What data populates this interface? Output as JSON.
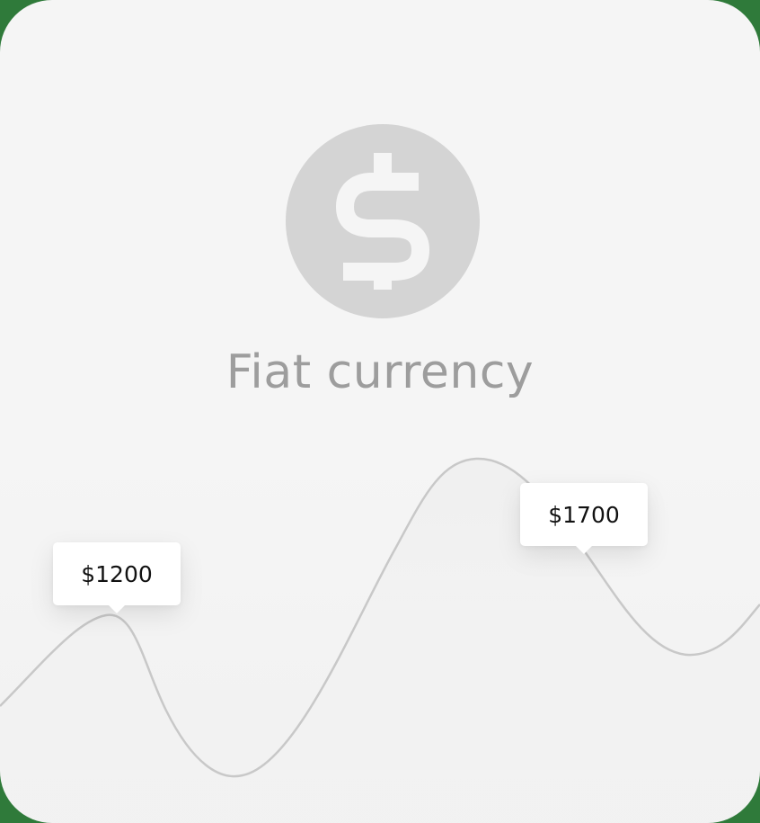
{
  "icon": {
    "name": "dollar-icon",
    "color": "#d4d4d4"
  },
  "title": "Fiat currency",
  "chart": {
    "line_color": "#c8c8c8",
    "tooltips": [
      {
        "label": "$1200"
      },
      {
        "label": "$1700"
      }
    ]
  }
}
